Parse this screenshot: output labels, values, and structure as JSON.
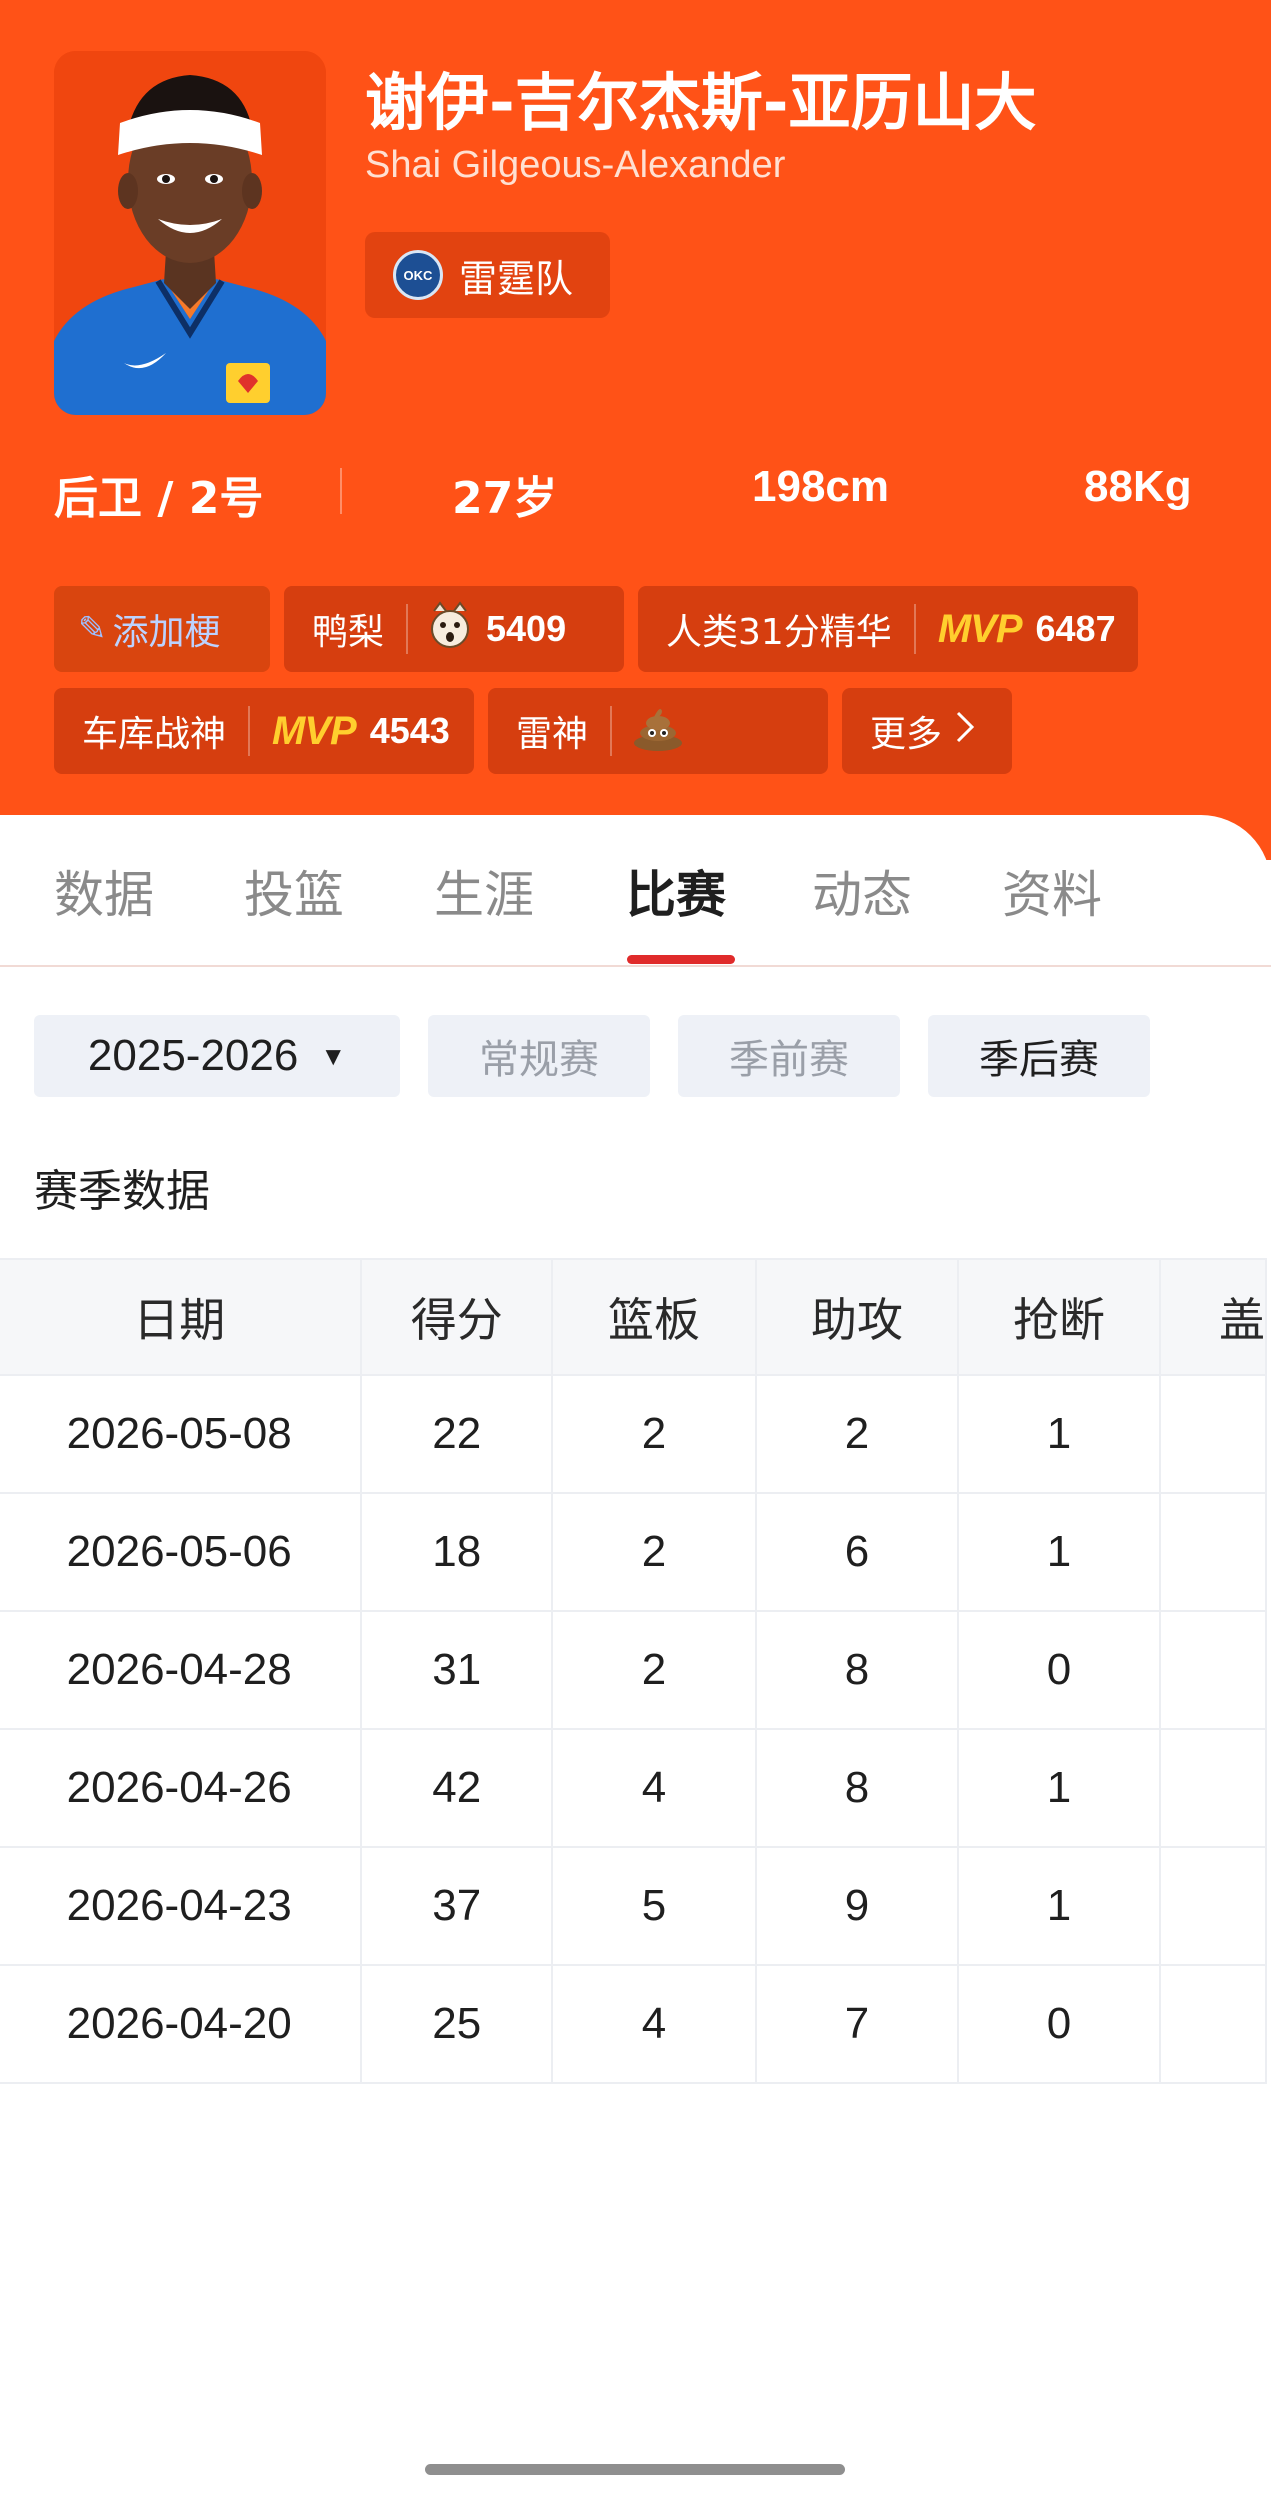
{
  "player": {
    "name_cn": "谢伊-吉尔杰斯-亚历山大",
    "name_en": "Shai Gilgeous-Alexander",
    "team": {
      "logo_text": "OKC",
      "name": "雷霆队"
    },
    "position_number": "后卫 / 2号",
    "age": "27岁",
    "height": "198cm",
    "weight": "88Kg",
    "jersey_brand": "Loves"
  },
  "tags": {
    "add_label": "添加梗",
    "items": [
      {
        "label": "鸭梨",
        "icon": "shocked-face-icon",
        "count": "5409"
      },
      {
        "label": "人类31分精华",
        "icon": "MVP",
        "count": "6487"
      },
      {
        "label": "车库战神",
        "icon": "MVP",
        "count": "4543"
      },
      {
        "label": "雷神",
        "icon": "poop-icon",
        "count": ""
      }
    ],
    "more_label": "更多"
  },
  "tabs": [
    "数据",
    "投篮",
    "生涯",
    "比赛",
    "动态",
    "资料"
  ],
  "active_tab": "比赛",
  "filters": {
    "season": "2025-2026",
    "types": [
      "常规赛",
      "季前赛",
      "季后赛"
    ],
    "selected": "季后赛"
  },
  "section_title": "赛季数据",
  "table": {
    "headers": [
      "日期",
      "得分",
      "篮板",
      "助攻",
      "抢断",
      "盖"
    ],
    "rows": [
      [
        "2026-05-08",
        "22",
        "2",
        "2",
        "1"
      ],
      [
        "2026-05-06",
        "18",
        "2",
        "6",
        "1"
      ],
      [
        "2026-04-28",
        "31",
        "2",
        "8",
        "0"
      ],
      [
        "2026-04-26",
        "42",
        "4",
        "8",
        "1"
      ],
      [
        "2026-04-23",
        "37",
        "5",
        "9",
        "1"
      ],
      [
        "2026-04-20",
        "25",
        "4",
        "7",
        "0"
      ]
    ]
  },
  "colors": {
    "header_bg": "#ff5217",
    "tag_bg": "#d63e0f",
    "mvp": "#ffcf2e",
    "tab_underline": "#e02b2b",
    "filter_bg": "#eef1f7"
  }
}
